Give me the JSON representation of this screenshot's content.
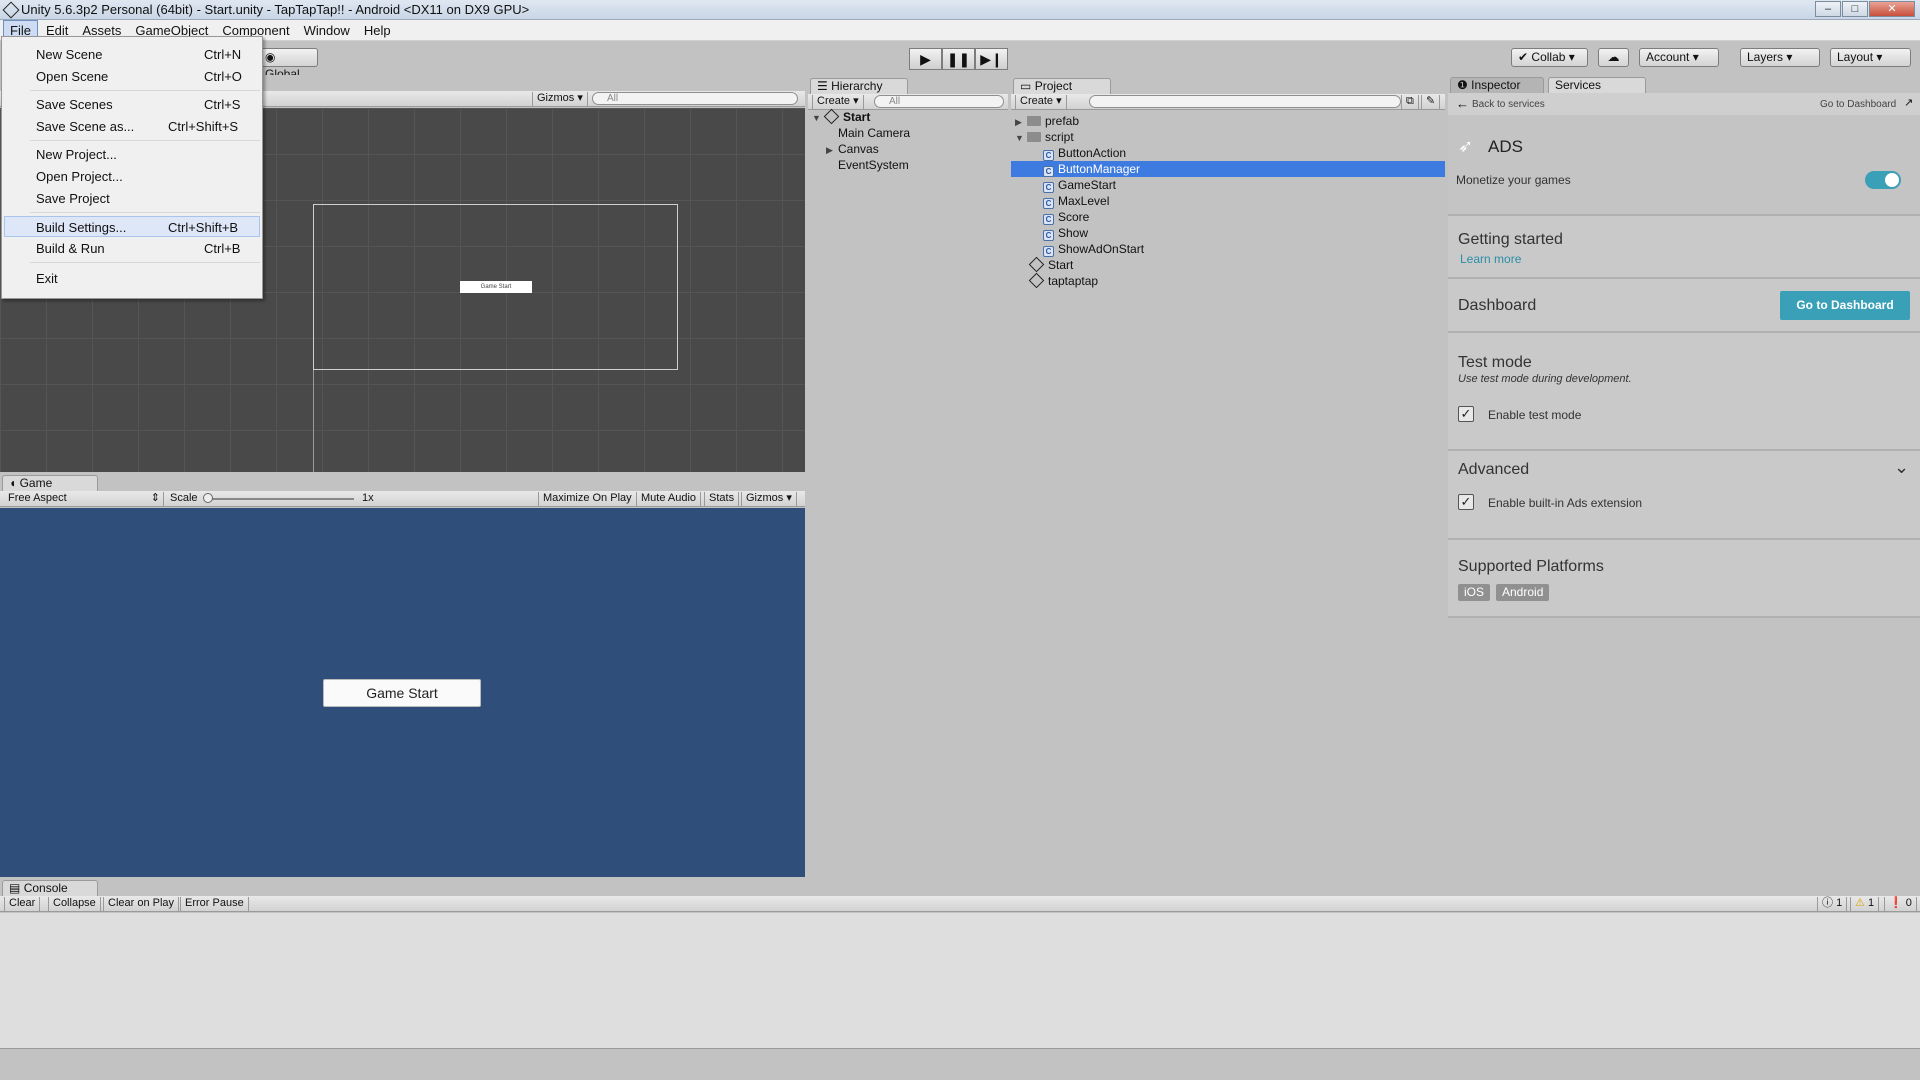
{
  "window": {
    "title": "Unity 5.6.3p2 Personal (64bit) - Start.unity - TapTapTap!! - Android <DX11 on DX9 GPU>"
  },
  "menubar": [
    "File",
    "Edit",
    "Assets",
    "GameObject",
    "Component",
    "Window",
    "Help"
  ],
  "file_menu": [
    {
      "label": "New Scene",
      "shortcut": "Ctrl+N"
    },
    {
      "label": "Open Scene",
      "shortcut": "Ctrl+O"
    },
    {
      "label": "Save Scenes",
      "shortcut": "Ctrl+S"
    },
    {
      "label": "Save Scene as...",
      "shortcut": "Ctrl+Shift+S"
    },
    {
      "label": "New Project...",
      "shortcut": ""
    },
    {
      "label": "Open Project...",
      "shortcut": ""
    },
    {
      "label": "Save Project",
      "shortcut": ""
    },
    {
      "label": "Build Settings...",
      "shortcut": "Ctrl+Shift+B"
    },
    {
      "label": "Build & Run",
      "shortcut": "Ctrl+B"
    },
    {
      "label": "Exit",
      "shortcut": ""
    }
  ],
  "toolbar": {
    "global": "Global",
    "collab": "Collab ▾",
    "account": "Account",
    "layers": "Layers",
    "layout": "Layout"
  },
  "scene": {
    "gizmos": "Gizmos",
    "search": "All",
    "button_label": "Game Start"
  },
  "game": {
    "tab": "Game",
    "aspect": "Free Aspect",
    "scale_label": "Scale",
    "scale_value": "1x",
    "maximize": "Maximize On Play",
    "mute": "Mute Audio",
    "stats": "Stats",
    "gizmos": "Gizmos",
    "button_label": "Game Start"
  },
  "hierarchy": {
    "tab": "Hierarchy",
    "create": "Create",
    "search": "All",
    "scene": "Start",
    "items": [
      "Main Camera",
      "Canvas",
      "EventSystem"
    ]
  },
  "project": {
    "tab": "Project",
    "create": "Create",
    "folders": [
      "prefab",
      "script"
    ],
    "scripts": [
      "ButtonAction",
      "ButtonManager",
      "GameStart",
      "MaxLevel",
      "Score",
      "Show",
      "ShowAdOnStart"
    ],
    "scenes": [
      "Start",
      "taptaptap"
    ]
  },
  "inspector": {
    "tab_inspector": "Inspector",
    "tab_services": "Services",
    "back": "Back to services",
    "goto": "Go to Dashboard",
    "ads_title": "ADS",
    "monetize": "Monetize your games",
    "getting_started": "Getting started",
    "learn_more": "Learn more",
    "dashboard": "Dashboard",
    "dashboard_btn": "Go to Dashboard",
    "test_mode": "Test mode",
    "test_desc": "Use test mode during development.",
    "enable_test": "Enable test mode",
    "advanced": "Advanced",
    "enable_ext": "Enable built-in Ads extension",
    "platforms": "Supported Platforms",
    "ios": "iOS",
    "android": "Android"
  },
  "console": {
    "tab": "Console",
    "clear": "Clear",
    "collapse": "Collapse",
    "clear_on_play": "Clear on Play",
    "error_pause": "Error Pause",
    "count_info": "1",
    "count_warn": "1",
    "count_error": "0"
  },
  "colors": {
    "game_bg": "#304e7a",
    "selection": "#3d7be0",
    "accent": "#3aa0b8"
  }
}
